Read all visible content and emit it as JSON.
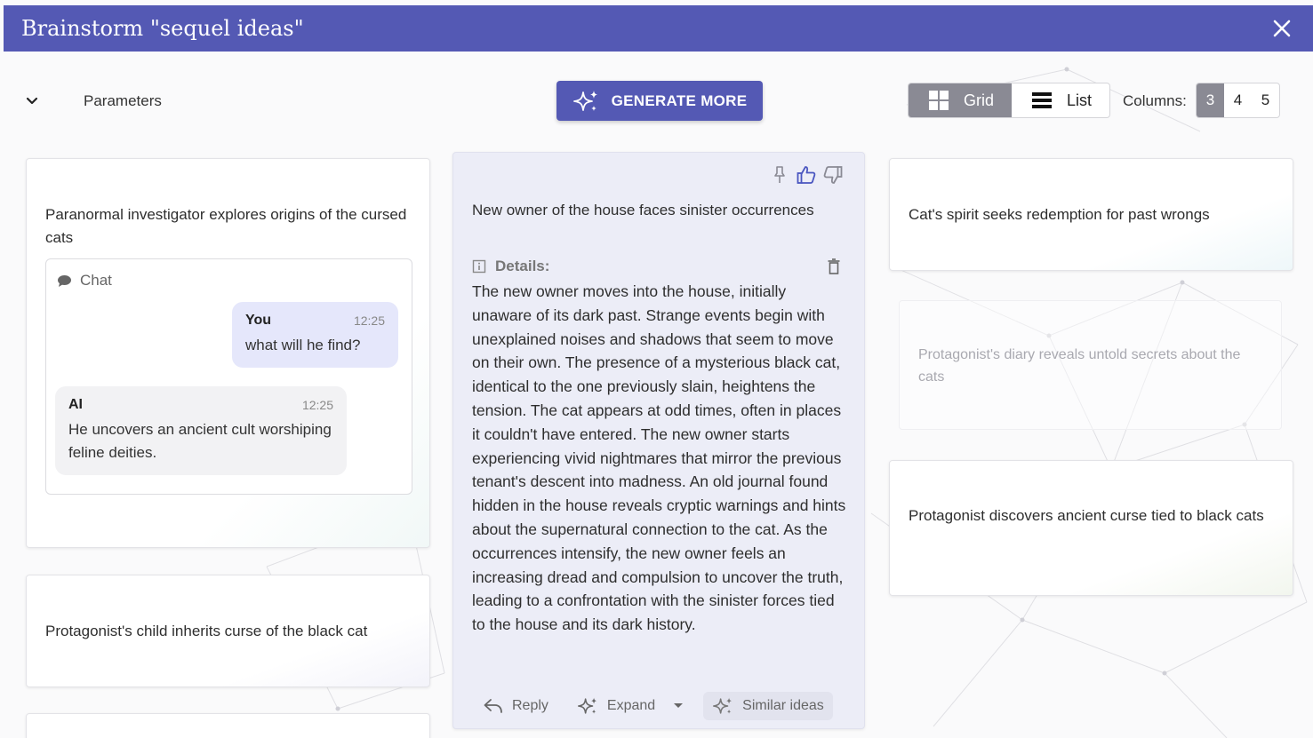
{
  "header": {
    "title": "Brainstorm \"sequel ideas\""
  },
  "toolbar": {
    "parameters_label": "Parameters",
    "generate_label": "GENERATE MORE",
    "view_grid_label": "Grid",
    "view_list_label": "List",
    "active_view": "grid",
    "columns_label": "Columns:",
    "columns_options": [
      "3",
      "4",
      "5"
    ],
    "active_columns": "3"
  },
  "cards": {
    "c1": {
      "title": "Paranormal investigator explores origins of the cursed cats",
      "chat": {
        "label": "Chat",
        "messages": [
          {
            "author": "You",
            "time": "12:25",
            "text": "what will he find?"
          },
          {
            "author": "AI",
            "time": "12:25",
            "text": "He uncovers an ancient cult worshiping feline deities."
          }
        ]
      }
    },
    "c2": {
      "title": "Protagonist's child inherits curse of the black cat"
    },
    "c3": {
      "title": "New owner of the house faces sinister occurrences",
      "details_label": "Details:",
      "details": "The new owner moves into the house, initially unaware of its dark past. Strange events begin with unexplained noises and shadows that seem to move on their own. The presence of a mysterious black cat, identical to the one previously slain, heightens the tension. The cat appears at odd times, often in places it couldn't have entered. The new owner starts experiencing vivid nightmares that mirror the previous tenant's descent into madness. An old journal found hidden in the house reveals cryptic warnings and hints about the supernatural connection to the cat. As the occurrences intensify, the new owner feels an increasing dread and compulsion to uncover the truth, leading to a confrontation with the sinister forces tied to the house and its dark history.",
      "reply_label": "Reply",
      "expand_label": "Expand",
      "similar_label": "Similar ideas"
    },
    "c4": {
      "title": "Cat's spirit seeks redemption for past wrongs"
    },
    "c5": {
      "title": "Protagonist's diary reveals untold secrets about the cats"
    },
    "c6": {
      "title": "Protagonist discovers ancient curse tied to black cats"
    }
  },
  "colors": {
    "accent": "#5459b4",
    "active_toggle": "#8a8a94",
    "liked_icon": "#4a56c0"
  },
  "icons": {
    "close": "close-icon",
    "collapse": "chevron-down-icon",
    "generate": "sparkle-icon",
    "grid": "grid-icon",
    "list": "list-icon",
    "chat": "chat-bubble-icon",
    "pin": "pin-icon",
    "like": "thumbs-up-icon",
    "dislike": "thumbs-down-icon",
    "info": "info-icon",
    "delete": "trash-icon",
    "reply": "reply-icon",
    "expand": "sparkle-icon",
    "similar": "sparkle-icon"
  }
}
